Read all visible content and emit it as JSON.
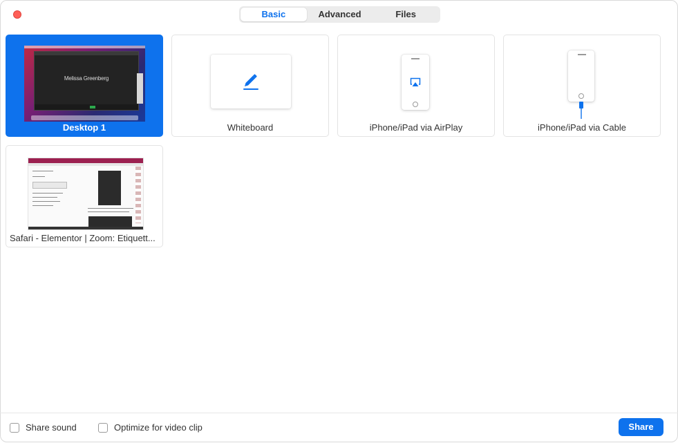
{
  "tabs": [
    {
      "label": "Basic",
      "active": true
    },
    {
      "label": "Advanced",
      "active": false
    },
    {
      "label": "Files",
      "active": false
    }
  ],
  "tiles": {
    "desktop": {
      "label": "Desktop 1",
      "thumbnail_text": "Melissa Greenberg",
      "selected": true
    },
    "whiteboard": {
      "label": "Whiteboard",
      "icon": "pencil-icon"
    },
    "airplay": {
      "label": "iPhone/iPad via AirPlay",
      "icon": "airplay-icon"
    },
    "cable": {
      "label": "iPhone/iPad via Cable",
      "icon": "cable-icon"
    },
    "safari": {
      "label": "Safari - Elementor | Zoom: Etiquett..."
    }
  },
  "footer": {
    "share_sound": "Share sound",
    "optimize_video": "Optimize for video clip",
    "share_button": "Share"
  },
  "colors": {
    "accent": "#0e72ed",
    "close": "#fe5f57"
  }
}
